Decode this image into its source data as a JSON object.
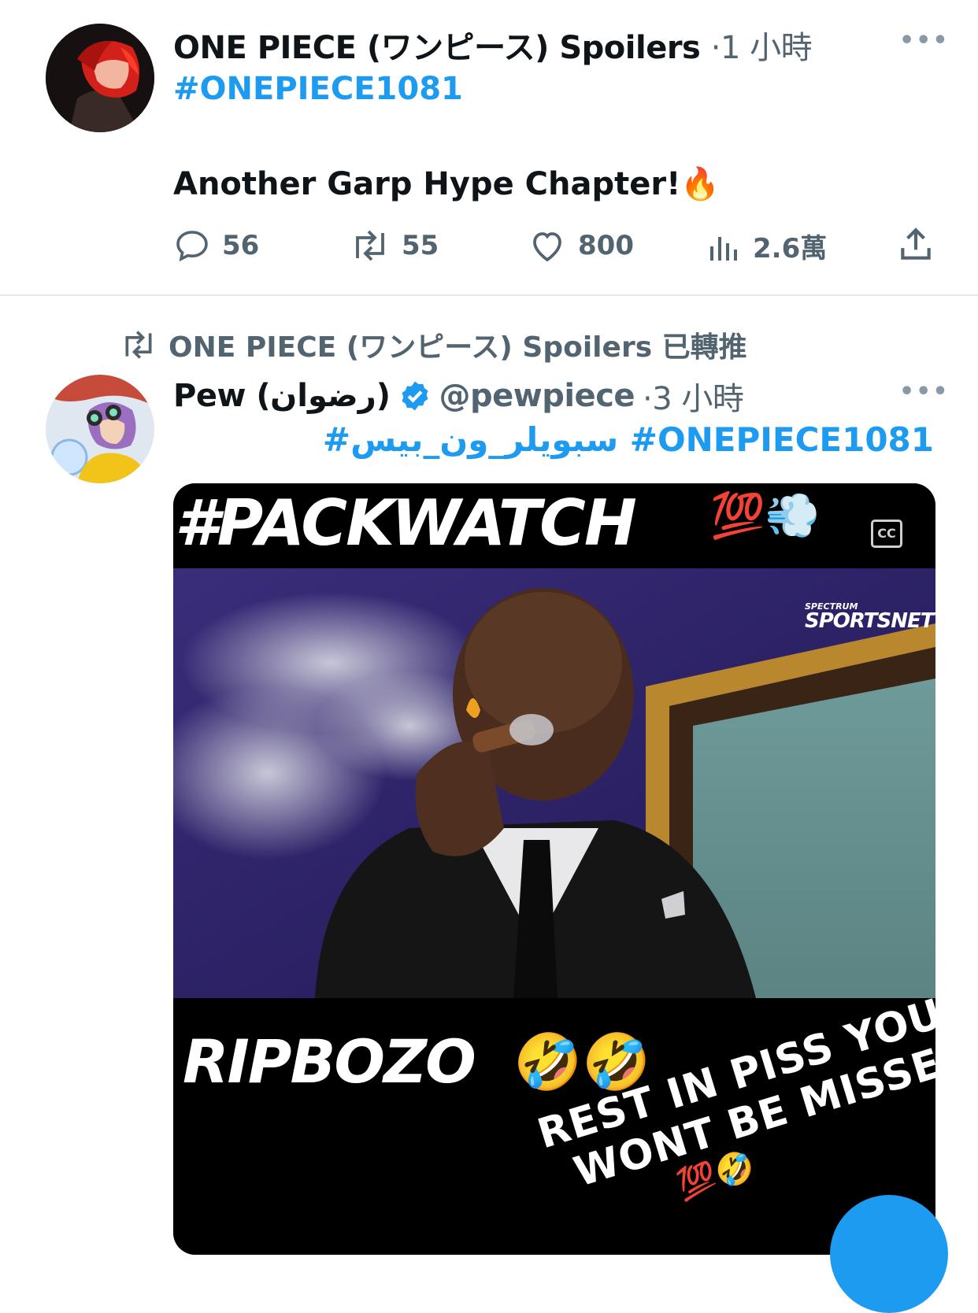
{
  "tweet1": {
    "author": "ONE PIECE (ワンピース) Spoilers",
    "time": "·1 小時",
    "hashtag": "#ONEPIECE1081",
    "text": "Another Garp Hype Chapter!",
    "emoji": "🔥",
    "stats": {
      "replies": "56",
      "retweets": "55",
      "likes": "800",
      "views": "2.6萬"
    }
  },
  "tweet2": {
    "retweet_label": "ONE PIECE (ワンピース) Spoilers 已轉推",
    "author": "Pew (رضوان)",
    "handle": "@pewpiece",
    "time": "·3 小時",
    "hashtags": "#سبويلر_ون_بيس #ONEPIECE1081",
    "media": {
      "top_caption": "#PACKWATCH",
      "top_emoji": "💯💨",
      "channel_logo_small": "SPECTRUM",
      "channel_logo": "SPORTSNET",
      "bottom_caption": "RIPBOZO",
      "bottom_emoji": "🤣🤣",
      "rotated_line1": "REST IN PISS YOU",
      "rotated_line2": "WONT BE MISSED",
      "rotated_emoji": "💯🤣",
      "cc_label": "CC"
    }
  },
  "icons": [
    "more-icon",
    "reply-icon",
    "retweet-icon",
    "like-icon",
    "views-icon",
    "share-icon",
    "verified-icon",
    "captions-icon"
  ],
  "colors": {
    "accent": "#1d9bf0",
    "muted": "#536471",
    "text": "#0f1419"
  }
}
